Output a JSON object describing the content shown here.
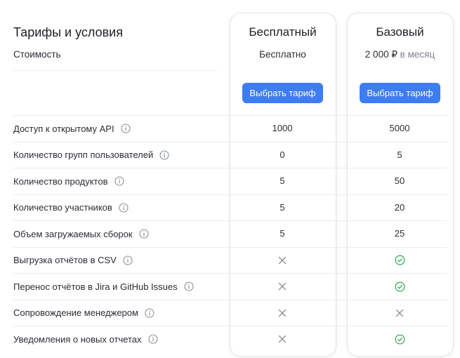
{
  "table": {
    "title": "Тарифы и условия",
    "cost_label": "Стоимость"
  },
  "plans": [
    {
      "name": "Бесплатный",
      "price": "Бесплатно",
      "period": "",
      "button_label": "Выбрать тариф"
    },
    {
      "name": "Базовый",
      "price": "2 000 ₽",
      "period": " в месяц",
      "button_label": "Выбрать тариф"
    }
  ],
  "features": [
    {
      "label": "Доступ к открытому API",
      "free": "1000",
      "base": "5000"
    },
    {
      "label": "Количество групп пользователей",
      "free": "0",
      "base": "5"
    },
    {
      "label": "Количество продуктов",
      "free": "5",
      "base": "50"
    },
    {
      "label": "Количество участников",
      "free": "5",
      "base": "20"
    },
    {
      "label": "Объем загружаемых сборок",
      "free": "5",
      "base": "25"
    },
    {
      "label": "Выгрузка отчётов в CSV",
      "free": "cross-icon",
      "base": "check-icon"
    },
    {
      "label": "Перенос отчётов в Jira и GitHub Issues",
      "free": "cross-icon",
      "base": "check-icon"
    },
    {
      "label": "Сопровождение менеджером",
      "free": "cross-icon",
      "base": "cross-icon"
    },
    {
      "label": "Уведомления о новых отчетах",
      "free": "cross-icon",
      "base": "check-icon"
    }
  ],
  "colors": {
    "accent": "#3d7cf2",
    "check": "#34a853",
    "cross": "#8a8f99",
    "info_icon": "#8a8f99"
  }
}
